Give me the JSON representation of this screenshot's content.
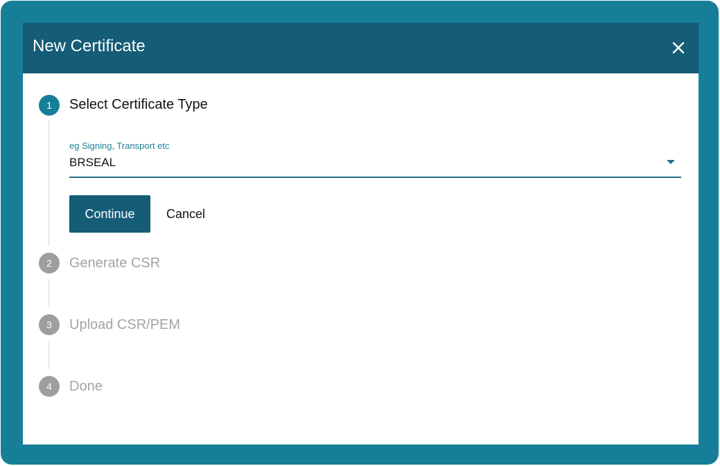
{
  "dialog": {
    "title": "New Certificate",
    "close_icon": "close-icon"
  },
  "steps": [
    {
      "number": "1",
      "label": "Select Certificate Type",
      "state": "active"
    },
    {
      "number": "2",
      "label": "Generate CSR",
      "state": "inactive"
    },
    {
      "number": "3",
      "label": "Upload CSR/PEM",
      "state": "inactive"
    },
    {
      "number": "4",
      "label": "Done",
      "state": "inactive"
    }
  ],
  "certificate_type": {
    "label": "eg Signing, Transport etc",
    "value": "BRSEAL",
    "arrow_icon": "dropdown-arrow-icon"
  },
  "actions": {
    "continue_label": "Continue",
    "cancel_label": "Cancel"
  },
  "colors": {
    "frame": "#167e98",
    "header": "#155c77",
    "active_step": "#167e98",
    "inactive_step": "#9e9e9e",
    "accent_text": "#1f7f99"
  }
}
